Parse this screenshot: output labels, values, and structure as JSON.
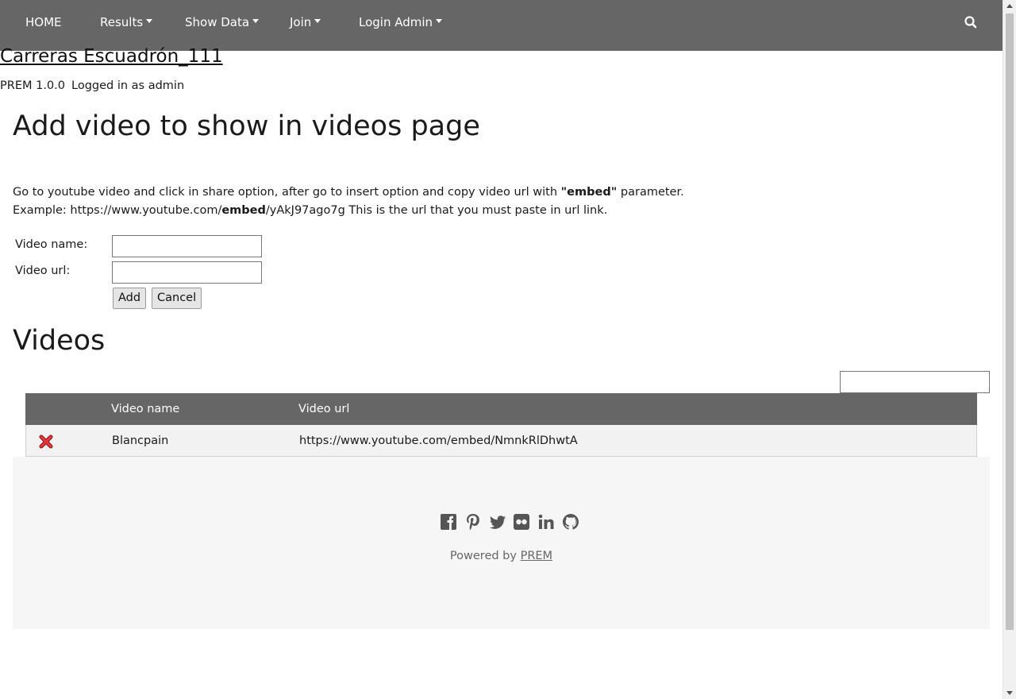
{
  "nav": {
    "home": "HOME",
    "results": "Results",
    "show_data": "Show Data",
    "join": "Join",
    "login_admin": "Login Admin"
  },
  "header": {
    "site_title": "Carreras Escuadrón_111",
    "version": "PREM 1.0.0",
    "logged_in": "Logged in as admin"
  },
  "form_section": {
    "heading": "Add video to show in videos page",
    "info_line1_pre": "Go to youtube video and click in share option, after go to insert option and copy video url with ",
    "info_line1_bold": "\"embed\"",
    "info_line1_post": " parameter.",
    "info_line2_pre": "Example: https://www.youtube.com/",
    "info_line2_bold": "embed",
    "info_line2_post": "/yAkJ97ago7g This is the url that you must paste in url link.",
    "name_label": "Video name:",
    "name_value": "",
    "url_label": "Video url:",
    "url_value": "",
    "add_button": "Add",
    "cancel_button": "Cancel"
  },
  "videos": {
    "heading": "Videos",
    "search_value": "",
    "columns": [
      "",
      "Video name",
      "Video url"
    ],
    "rows": [
      {
        "name": "Blancpain",
        "url": "https://www.youtube.com/embed/NmnkRlDhwtA",
        "action_icon": "delete-icon"
      }
    ]
  },
  "footer": {
    "social_icons": [
      "facebook-icon",
      "pinterest-icon",
      "twitter-icon",
      "flickr-icon",
      "linkedin-icon",
      "github-icon"
    ],
    "powered_by": "Powered by",
    "powered_link": "PREM"
  },
  "colors": {
    "nav_bg": "#666666",
    "footer_bg": "#f6f6f6",
    "row_bg": "#f2f2f2",
    "delete": "#d9262c"
  }
}
